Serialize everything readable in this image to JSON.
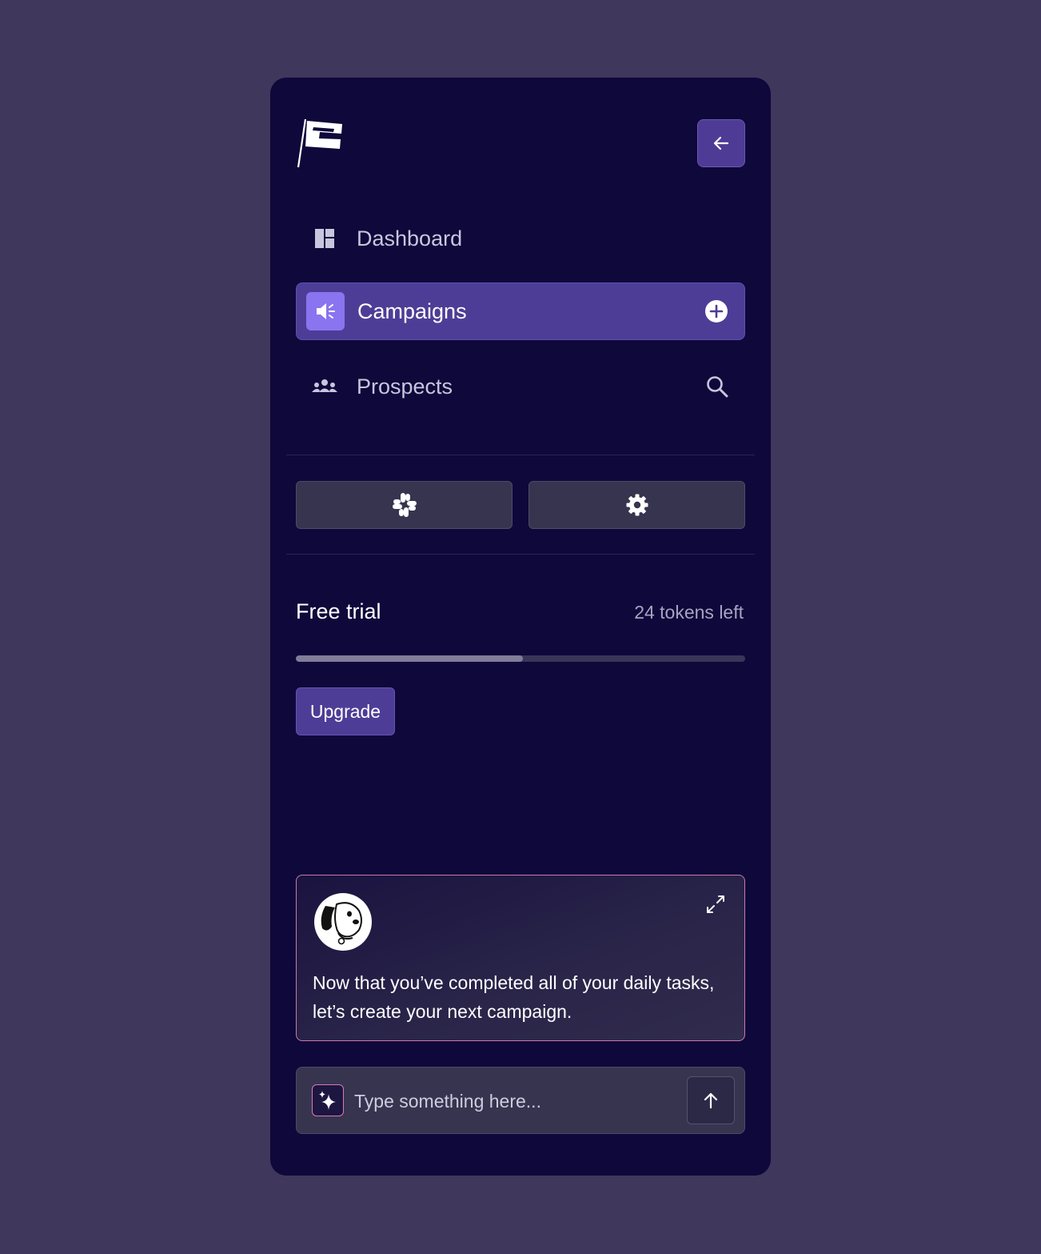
{
  "sidebar": {
    "logo_icon": "flag-logo-icon",
    "collapse_icon": "arrow-left-icon",
    "nav": [
      {
        "label": "Dashboard",
        "icon": "dashboard-icon"
      },
      {
        "label": "Campaigns",
        "icon": "megaphone-icon",
        "active": true,
        "trailing_icon": "plus-circle-icon"
      },
      {
        "label": "Prospects",
        "icon": "people-icon",
        "trailing_icon": "search-icon"
      }
    ],
    "tools": [
      {
        "icon": "slack-icon"
      },
      {
        "icon": "gear-icon"
      }
    ]
  },
  "trial": {
    "title": "Free trial",
    "tokens": "24 tokens left",
    "progress": 0.505,
    "upgrade_label": "Upgrade"
  },
  "assistant": {
    "avatar_icon": "dog-avatar",
    "expand_icon": "expand-icon",
    "message": "Now that you’ve completed all of your daily tasks, let’s create your next campaign."
  },
  "chat": {
    "placeholder": "Type something here...",
    "value": "",
    "sparkle_icon": "sparkle-icon",
    "send_icon": "arrow-up-icon"
  },
  "colors": {
    "background": "#3f375c",
    "panel": "#0f083a",
    "accent": "#4e3d96",
    "accent_light": "#8b74ef"
  }
}
